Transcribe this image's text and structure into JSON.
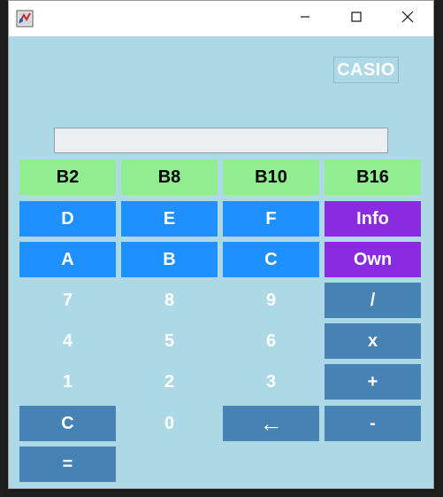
{
  "window": {
    "title": "",
    "icon": "java-app-icon",
    "controls": {
      "minimize": "minimize-icon",
      "maximize": "maximize-icon",
      "close": "close-icon"
    }
  },
  "brand": {
    "label": "CASIO"
  },
  "display": {
    "value": "",
    "placeholder": ""
  },
  "colors": {
    "background": "#add8e6",
    "base_buttons": "#90ee90",
    "hex_digits": "#1e90ff",
    "info_buttons": "#8a2be2",
    "operators": "#4682b4"
  },
  "keys": {
    "b2": "B2",
    "b8": "B8",
    "b10": "B10",
    "b16": "B16",
    "d": "D",
    "e": "E",
    "f": "F",
    "info": "Info",
    "a": "A",
    "b": "B",
    "c_hex": "C",
    "own": "Own",
    "seven": "7",
    "eight": "8",
    "nine": "9",
    "divide": "/",
    "four": "4",
    "five": "5",
    "six": "6",
    "multiply": "x",
    "one": "1",
    "two": "2",
    "three": "3",
    "plus": "+",
    "clear": "C",
    "zero": "0",
    "backspace": "←",
    "minus": "-",
    "equals": "="
  }
}
